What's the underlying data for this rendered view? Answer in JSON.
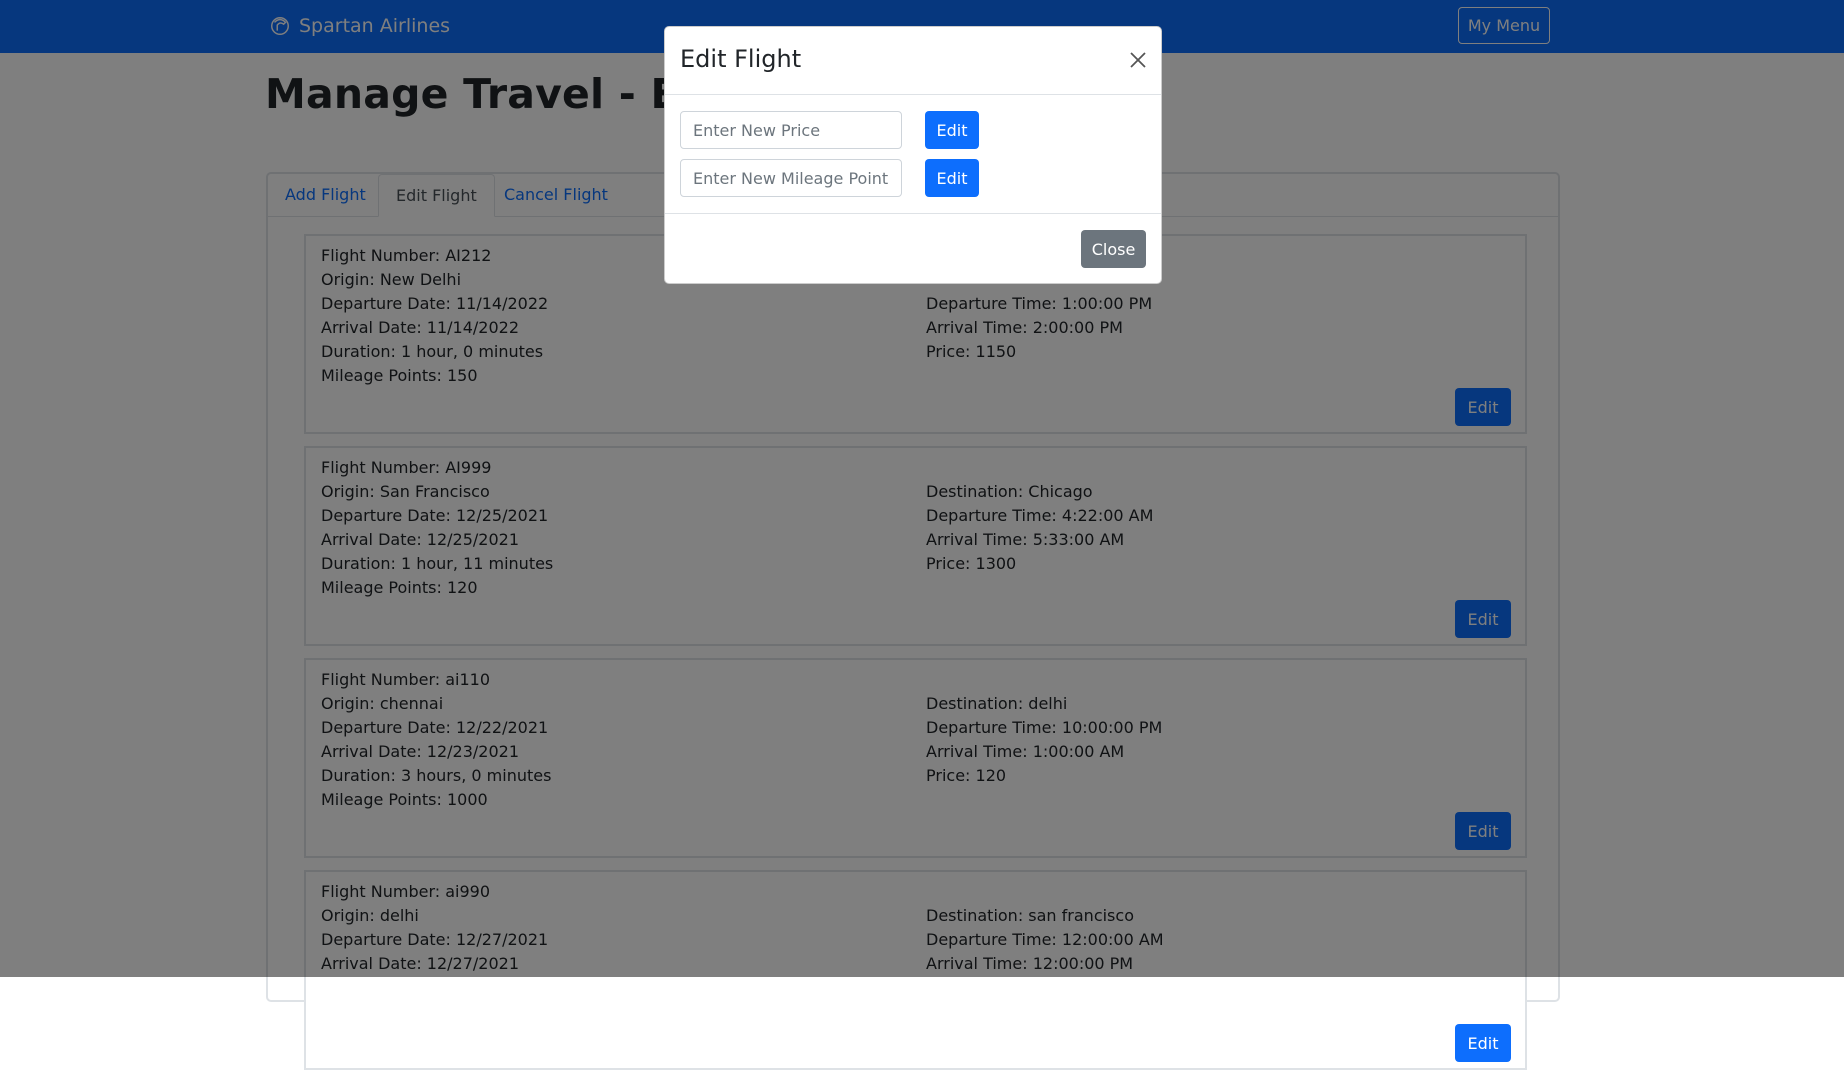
{
  "navbar": {
    "brand": "Spartan Airlines",
    "menu_button": "My Menu"
  },
  "page": {
    "title": "Manage Travel - Employee"
  },
  "tabs": [
    {
      "label": "Add Flight",
      "active": false
    },
    {
      "label": "Edit Flight",
      "active": true
    },
    {
      "label": "Cancel Flight",
      "active": false
    }
  ],
  "flights": [
    {
      "left": [
        "Flight Number: AI212",
        "Origin: New Delhi",
        "Departure Date: 11/14/2022",
        "Arrival Date: 11/14/2022",
        "Duration: 1 hour, 0 minutes",
        "Mileage Points: 150"
      ],
      "right": [
        "",
        "",
        "Departure Time: 1:00:00 PM",
        "Arrival Time: 2:00:00 PM",
        "Price: 1150",
        ""
      ],
      "edit_label": "Edit"
    },
    {
      "left": [
        "Flight Number: AI999",
        "Origin: San Francisco",
        "Departure Date: 12/25/2021",
        "Arrival Date: 12/25/2021",
        "Duration: 1 hour, 11 minutes",
        "Mileage Points: 120"
      ],
      "right": [
        "",
        "Destination: Chicago",
        "Departure Time: 4:22:00 AM",
        "Arrival Time: 5:33:00 AM",
        "Price: 1300",
        ""
      ],
      "edit_label": "Edit"
    },
    {
      "left": [
        "Flight Number: ai110",
        "Origin: chennai",
        "Departure Date: 12/22/2021",
        "Arrival Date: 12/23/2021",
        "Duration: 3 hours, 0 minutes",
        "Mileage Points: 1000"
      ],
      "right": [
        "",
        "Destination: delhi",
        "Departure Time: 10:00:00 PM",
        "Arrival Time: 1:00:00 AM",
        "Price: 120",
        ""
      ],
      "edit_label": "Edit"
    },
    {
      "left": [
        "Flight Number: ai990",
        "Origin: delhi",
        "Departure Date: 12/27/2021",
        "Arrival Date: 12/27/2021",
        "",
        ""
      ],
      "right": [
        "",
        "Destination: san francisco",
        "Departure Time: 12:00:00 AM",
        "Arrival Time: 12:00:00 PM",
        "",
        ""
      ],
      "edit_label": "Edit"
    }
  ],
  "modal": {
    "title": "Edit Flight",
    "price_placeholder": "Enter New Price",
    "price_edit_label": "Edit",
    "mileage_placeholder": "Enter New Mileage Points",
    "mileage_edit_label": "Edit",
    "close_label": "Close"
  },
  "colors": {
    "primary": "#0d6efd",
    "secondary": "#6c757d",
    "backdrop": "rgba(0,0,0,0.5)"
  }
}
